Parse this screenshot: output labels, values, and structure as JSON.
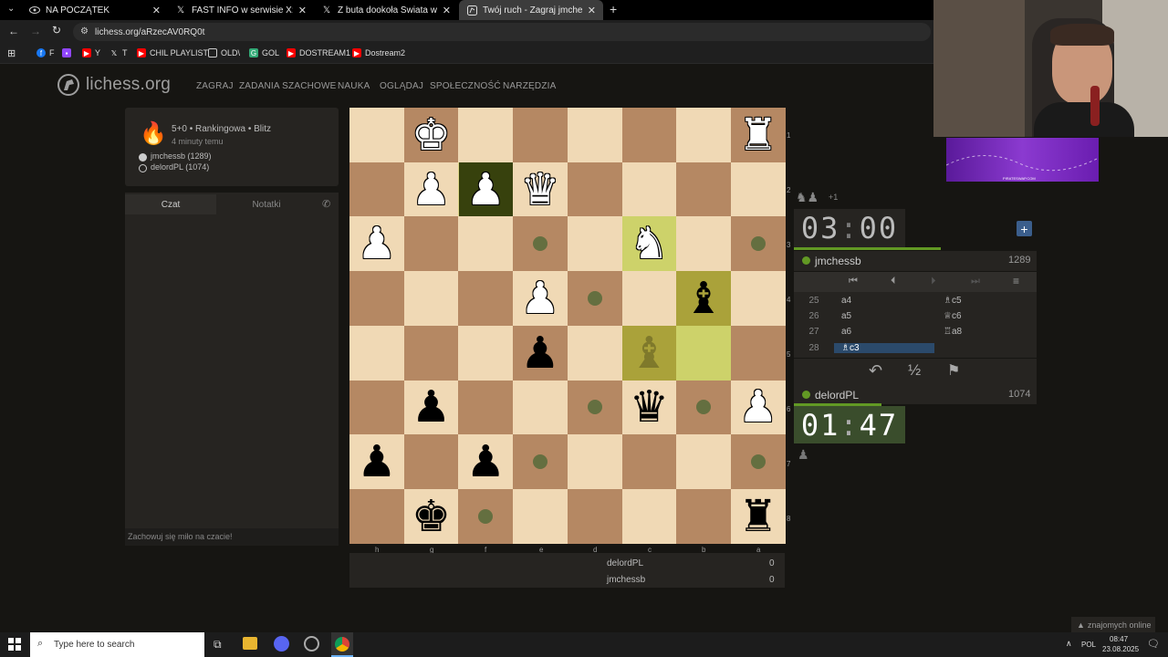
{
  "browser": {
    "tabs": [
      {
        "label": "NA POCZĄTEK",
        "icon": "eye-icon"
      },
      {
        "label": "FAST INFO w serwisie X: „BEST…",
        "icon": "x-icon"
      },
      {
        "label": "Z buta dookoła Świata w serwi…",
        "icon": "x-icon"
      },
      {
        "label": "Twój ruch - Zagraj jmchessb • li…",
        "icon": "lichess-icon"
      }
    ],
    "url": "lichess.org/aRzecAV0RQ0t",
    "bookmarks": [
      "F",
      "Y",
      "T",
      "CHIL PLAYLIST",
      "OLD\\",
      "GOL",
      "DOSTREAM1",
      "Dostream2"
    ]
  },
  "site": {
    "logo": "lichess.org",
    "nav": [
      "ZAGRAJ",
      "ZADANIA SZACHOWE",
      "NAUKA",
      "OGLĄDAJ",
      "SPOŁECZNOŚĆ",
      "NARZĘDZIA"
    ]
  },
  "game_info": {
    "mode": "5+0 • Rankingowa • Blitz",
    "time_ago": "4 minuty temu",
    "white": "jmchessb (1289)",
    "black": "delordPL (1074)"
  },
  "chat": {
    "tab_chat": "Czat",
    "tab_notes": "Notatki",
    "placeholder": "Zachowuj się miło na czacie!"
  },
  "board": {
    "ranks": [
      "1",
      "2",
      "3",
      "4",
      "5",
      "6",
      "7",
      "8"
    ],
    "files": [
      "h",
      "g",
      "f",
      "e",
      "d",
      "c",
      "b",
      "a"
    ]
  },
  "scores": {
    "rows": [
      {
        "name": "delordPL",
        "score": "0"
      },
      {
        "name": "jmchessb",
        "score": "0"
      }
    ]
  },
  "right": {
    "material": "+1",
    "top_clock": {
      "min": "03",
      "sep": ":",
      "sec": "00"
    },
    "top_player": {
      "name": "jmchessb",
      "rating": "1289"
    },
    "moves": [
      {
        "n": "25",
        "w": "a4",
        "b": "♗c5"
      },
      {
        "n": "26",
        "w": "a5",
        "b": "♕c6"
      },
      {
        "n": "27",
        "w": "a6",
        "b": "♖a8"
      },
      {
        "n": "28",
        "w": "♗c3",
        "b": ""
      }
    ],
    "bottom_player": {
      "name": "delordPL",
      "rating": "1074"
    },
    "bottom_clock": {
      "min": "01",
      "sep": ":",
      "sec": "47"
    },
    "half": "½"
  },
  "stream": {
    "banner": "PIRATESWAP.COM"
  },
  "friends": "znajomych online",
  "taskbar": {
    "search": "Type here to search",
    "lang": "POL",
    "time": "08:47",
    "date": "23.08.2025"
  }
}
